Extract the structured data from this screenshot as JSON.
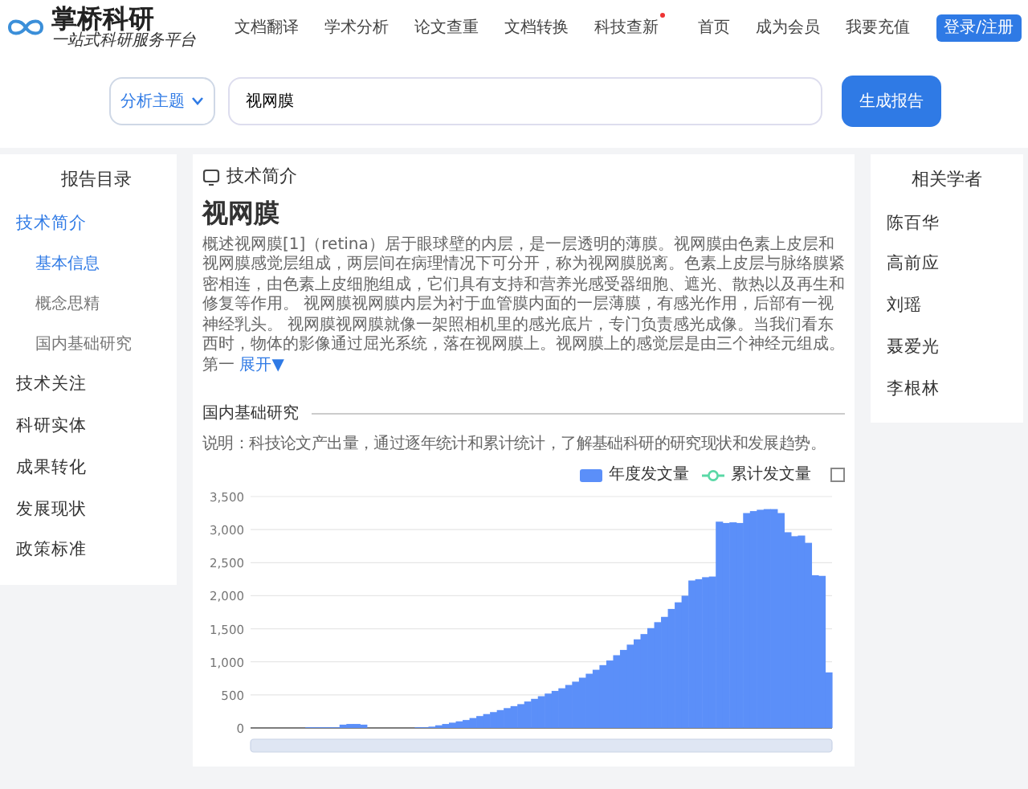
{
  "header": {
    "logo": {
      "name": "掌桥科研",
      "slogan": "一站式科研服务平台"
    },
    "nav": [
      {
        "label": "文档翻译",
        "dot": false
      },
      {
        "label": "学术分析",
        "dot": false
      },
      {
        "label": "论文查重",
        "dot": false
      },
      {
        "label": "文档转换",
        "dot": false
      },
      {
        "label": "科技查新",
        "dot": true
      }
    ],
    "links": [
      "首页",
      "成为会员",
      "我要充值"
    ],
    "login": "登录/注册"
  },
  "search": {
    "scope": "分析主题",
    "value": "视网膜",
    "button": "生成报告"
  },
  "sidebar": {
    "title": "报告目录",
    "items": [
      {
        "label": "技术简介",
        "selected": true,
        "children": [
          {
            "label": "基本信息",
            "selected": true
          },
          {
            "label": "概念思精",
            "selected": false
          },
          {
            "label": "国内基础研究",
            "selected": false
          }
        ]
      },
      {
        "label": "技术关注",
        "selected": false
      },
      {
        "label": "科研实体",
        "selected": false
      },
      {
        "label": "成果转化",
        "selected": false
      },
      {
        "label": "发展现状",
        "selected": false
      },
      {
        "label": "政策标准",
        "selected": false
      }
    ]
  },
  "main": {
    "heading": "技术简介",
    "title": "视网膜",
    "summary": "概述视网膜[1]（retina）居于眼球壁的内层，是一层透明的薄膜。视网膜由色素上皮层和视网膜感觉层组成，两层间在病理情况下可分开，称为视网膜脱离。色素上皮层与脉络膜紧密相连，由色素上皮细胞组成，它们具有支持和营养光感受器细胞、遮光、散热以及再生和修复等作用。 视网膜视网膜内层为衬于血管膜内面的一层薄膜，有感光作用，后部有一视神经乳头。 视网膜视网膜就像一架照相机里的感光底片，专门负责感光成像。当我们看东西时，物体的影像通过屈光系统，落在视网膜上。视网膜上的感觉层是由三个神经元组成。第一",
    "expand": "展开▼",
    "section": {
      "title": "国内基础研究",
      "note": "说明：科技论文产出量，通过逐年统计和累计统计，了解基础科研的研究现状和发展趋势。",
      "legend": [
        {
          "label": "累计发文量",
          "kind": "line",
          "color": "#5ad8a6"
        }
      ],
      "chart_data": {
        "type": "bar",
        "grid": true,
        "ylim": [
          0,
          3500
        ],
        "yticks": [
          {
            "value": 0,
            "label": "0"
          },
          {
            "value": 500,
            "label": "500"
          },
          {
            "value": 1000,
            "label": "1,000"
          },
          {
            "value": 1500,
            "label": "1,500"
          },
          {
            "value": 2000,
            "label": "2,000"
          },
          {
            "value": 2500,
            "label": "2,500"
          },
          {
            "value": 3000,
            "label": "3,000"
          },
          {
            "value": 3500,
            "label": "3,500"
          }
        ],
        "series": [
          {
            "name": "年度发文量",
            "color": "#5b8ff9",
            "values": [
              0,
              0,
              0,
              0,
              0,
              0,
              0,
              0,
              10,
              10,
              10,
              10,
              10,
              50,
              60,
              60,
              50,
              0,
              0,
              0,
              0,
              0,
              0,
              0,
              10,
              10,
              20,
              40,
              60,
              80,
              100,
              120,
              150,
              180,
              210,
              240,
              270,
              300,
              330,
              360,
              400,
              440,
              480,
              520,
              560,
              600,
              650,
              700,
              760,
              820,
              880,
              950,
              1020,
              1100,
              1180,
              1260,
              1340,
              1420,
              1510,
              1600,
              1680,
              1800,
              1900,
              2000,
              2230,
              2250,
              2280,
              2290,
              3120,
              3100,
              3110,
              3100,
              3250,
              3280,
              3300,
              3310,
              3310,
              3250,
              2960,
              2900,
              2910,
              2800,
              2310,
              2300,
              840
            ]
          }
        ]
      }
    }
  },
  "scholars": {
    "title": "相关学者",
    "names": [
      "陈百华",
      "高前应",
      "刘瑶",
      "聂爱光",
      "李根林"
    ]
  }
}
